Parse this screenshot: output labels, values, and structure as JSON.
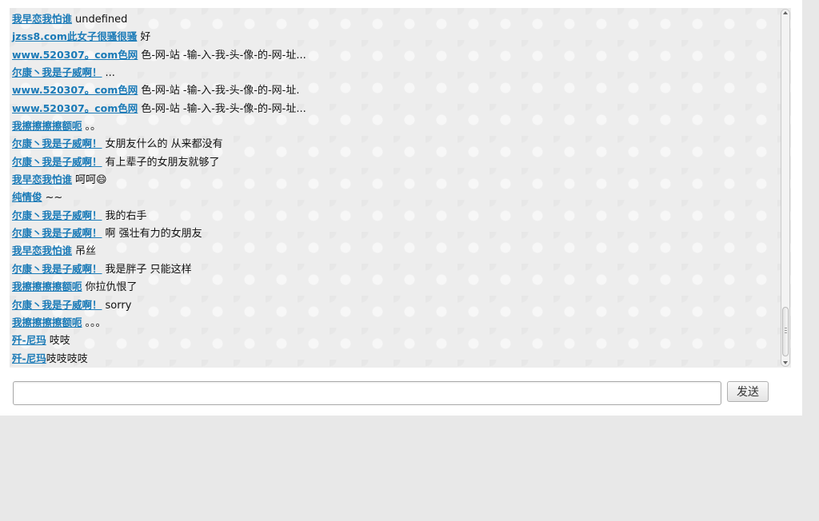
{
  "messages": [
    {
      "user": "我早恋我怕谁",
      "text": "undefined"
    },
    {
      "user": "jzss8.com此女子很骚很骚",
      "text": "好"
    },
    {
      "user": "www.520307。com色网",
      "text": "色-网-站 -输-入-我-头-像-的-网-址..."
    },
    {
      "user": "尔康丶我是子威啊！",
      "text": "..."
    },
    {
      "user": "www.520307。com色网",
      "text": "色-网-站 -输-入-我-头-像-的-网-址."
    },
    {
      "user": "www.520307。com色网",
      "text": "色-网-站 -输-入-我-头-像-的-网-址..."
    },
    {
      "user": "我擦擦擦擦额呃",
      "text": "。。"
    },
    {
      "user": "尔康丶我是子威啊！",
      "text": "女朋友什么的 从来都没有"
    },
    {
      "user": "尔康丶我是子威啊！",
      "text": "有上辈子的女朋友就够了"
    },
    {
      "user": "我早恋我怕谁",
      "text": "呵呵😄"
    },
    {
      "user": "纯情俊",
      "text": "~~"
    },
    {
      "user": "尔康丶我是子威啊！",
      "text": "我的右手"
    },
    {
      "user": "尔康丶我是子威啊！",
      "text": "啊 强壮有力的女朋友"
    },
    {
      "user": "我早恋我怕谁",
      "text": "吊丝"
    },
    {
      "user": "尔康丶我是子威啊！",
      "text": "我是胖子 只能这样"
    },
    {
      "user": "我擦擦擦擦额呃",
      "text": "你拉仇恨了"
    },
    {
      "user": "尔康丶我是子威啊！",
      "text": "sorry"
    },
    {
      "user": "我擦擦擦擦额呃",
      "text": "。。。"
    },
    {
      "user": "歼-尼玛",
      "text": "吱吱"
    },
    {
      "user": "歼-尼玛",
      "text": "吱吱吱吱"
    }
  ],
  "composer": {
    "input_value": "",
    "send_label": "发送"
  },
  "colors": {
    "username_link": "#1a7ab7",
    "log_background": "#ededed"
  }
}
